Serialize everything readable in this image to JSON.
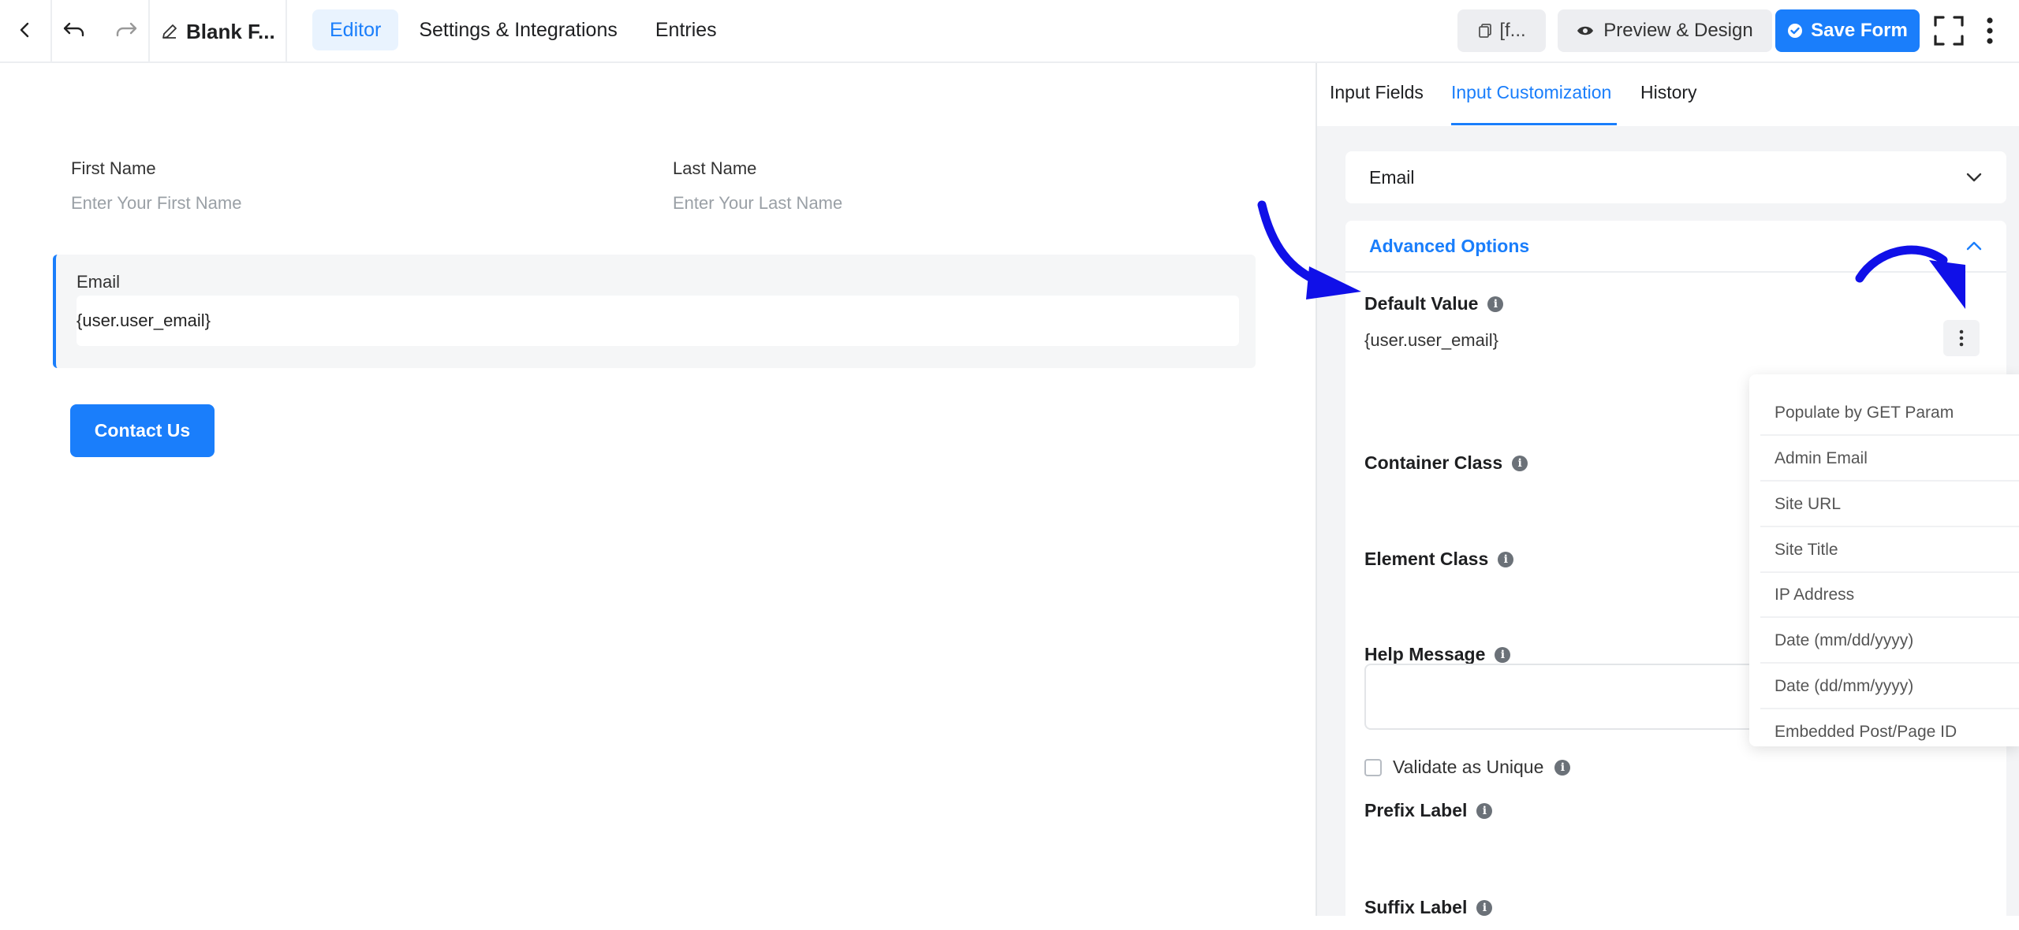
{
  "topbar": {
    "form_title": "Blank F...",
    "tabs": [
      {
        "label": "Editor",
        "active": true
      },
      {
        "label": "Settings & Integrations",
        "active": false
      },
      {
        "label": "Entries",
        "active": false
      }
    ],
    "shortcode_label": "[f...",
    "preview_label": "Preview & Design",
    "save_label": "Save Form"
  },
  "canvas": {
    "first_name": {
      "label": "First Name",
      "placeholder": "Enter Your First Name"
    },
    "last_name": {
      "label": "Last Name",
      "placeholder": "Enter Your Last Name"
    },
    "email": {
      "label": "Email",
      "value": "{user.user_email}"
    },
    "submit_label": "Contact Us"
  },
  "panel": {
    "tabs": [
      {
        "label": "Input Fields",
        "active": false
      },
      {
        "label": "Input Customization",
        "active": true
      },
      {
        "label": "History",
        "active": false
      }
    ],
    "selected_field": "Email",
    "advanced_title": "Advanced Options",
    "default_value_label": "Default Value",
    "default_value": "{user.user_email}",
    "container_class_label": "Container Class",
    "element_class_label": "Element Class",
    "help_message_label": "Help Message",
    "validate_label": "Validate as Unique",
    "prefix_label": "Prefix Label",
    "suffix_label": "Suffix Label"
  },
  "smart_codes": [
    "Populate by GET Param",
    "Admin Email",
    "Site URL",
    "Site Title",
    "IP Address",
    "Date (mm/dd/yyyy)",
    "Date (dd/mm/yyyy)",
    "Embedded Post/Page ID"
  ],
  "colors": {
    "accent": "#1a7efb",
    "annotation": "#1010e8"
  }
}
